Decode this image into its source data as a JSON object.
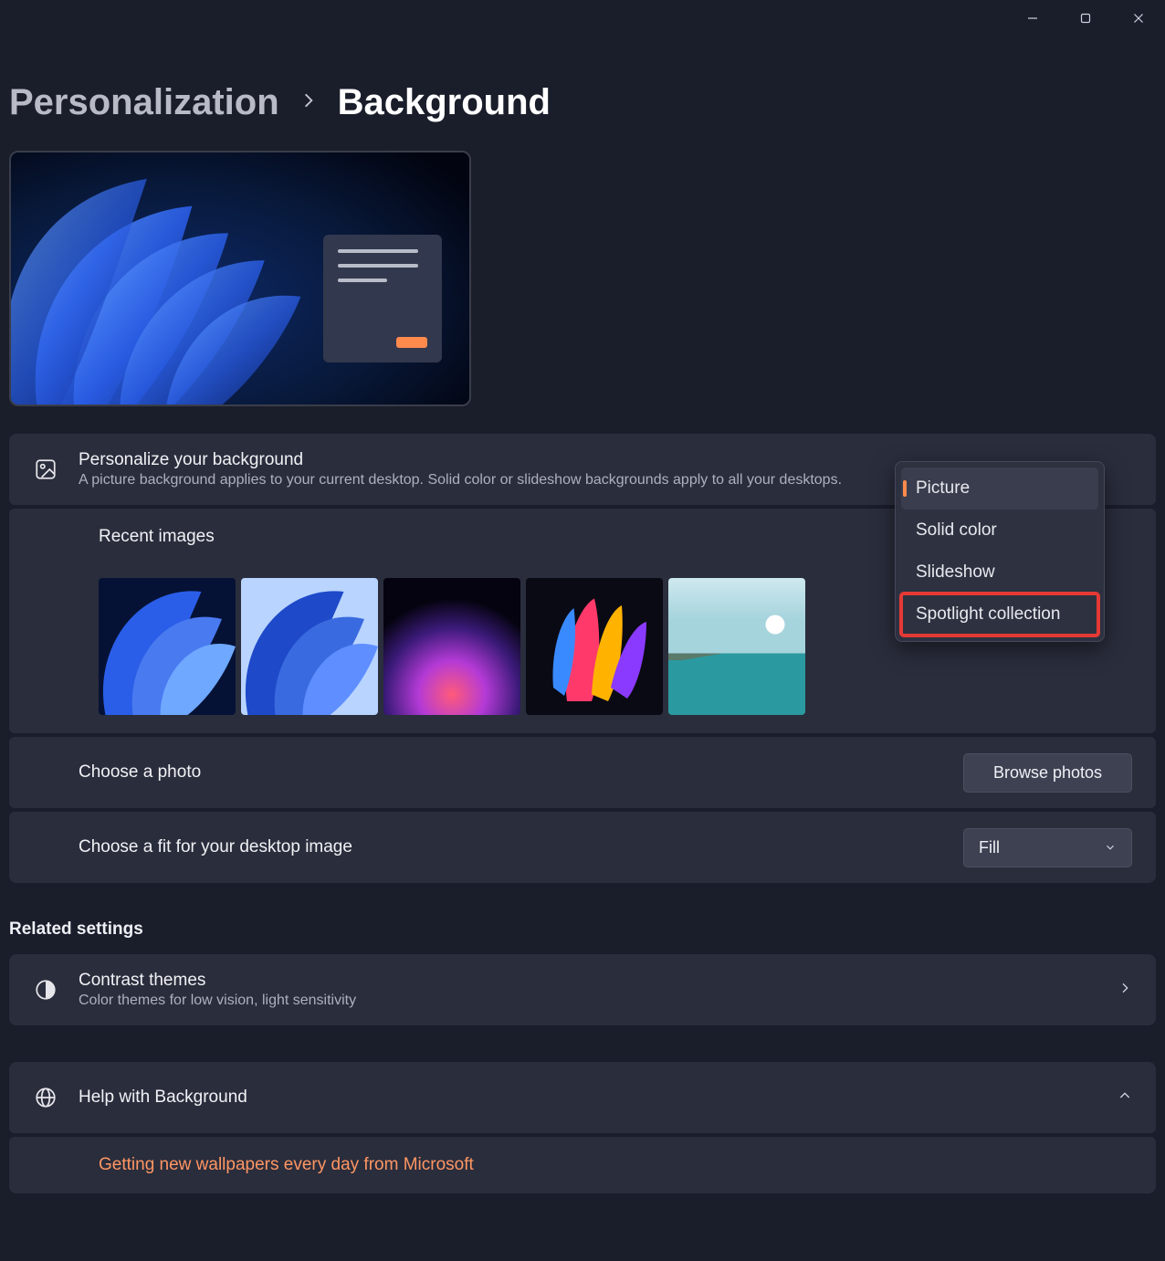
{
  "colors": {
    "accent": "#ff8a4c",
    "highlight": "#e53935"
  },
  "breadcrumb": {
    "parent": "Personalization",
    "current": "Background"
  },
  "personalize": {
    "title": "Personalize your background",
    "description": "A picture background applies to your current desktop. Solid color or slideshow backgrounds apply to all your desktops."
  },
  "dropdown": {
    "options": [
      "Picture",
      "Solid color",
      "Slideshow",
      "Spotlight collection"
    ],
    "selected": "Picture",
    "highlighted": "Spotlight collection"
  },
  "recent": {
    "title": "Recent images"
  },
  "choose_photo": {
    "label": "Choose a photo",
    "button": "Browse photos"
  },
  "fit": {
    "label": "Choose a fit for your desktop image",
    "value": "Fill"
  },
  "related": {
    "heading": "Related settings",
    "contrast": {
      "title": "Contrast themes",
      "sub": "Color themes for low vision, light sensitivity"
    }
  },
  "help": {
    "title": "Help with Background",
    "link": "Getting new wallpapers every day from Microsoft"
  }
}
